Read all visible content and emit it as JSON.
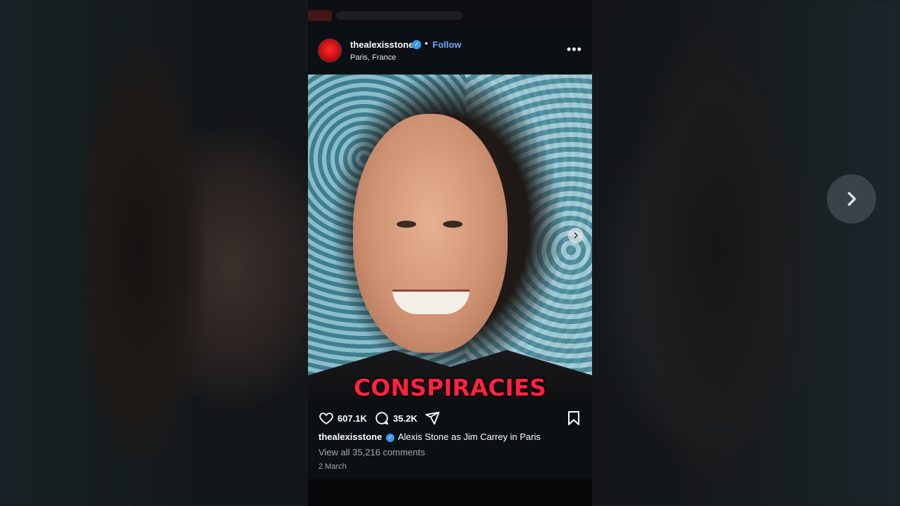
{
  "post": {
    "username": "thealexisstone",
    "separator": "•",
    "follow_label": "Follow",
    "location": "Paris, France",
    "more_label": "•••",
    "overlay_text": "CONSPIRACIES",
    "likes": "607.1K",
    "comments": "35.2K",
    "caption_username": "thealexisstone",
    "caption_text": "Alexis Stone as Jim Carrey in Paris",
    "view_all_comments": "View all 35,216 comments",
    "date": "2 March"
  },
  "colors": {
    "accent_follow": "#6fa8ff",
    "verified": "#3897f0",
    "overlay_text": "#ff2240"
  },
  "icons": [
    "verified-icon",
    "more-options-icon",
    "chevron-right-icon",
    "heart-icon",
    "comment-icon",
    "share-icon",
    "bookmark-icon"
  ]
}
